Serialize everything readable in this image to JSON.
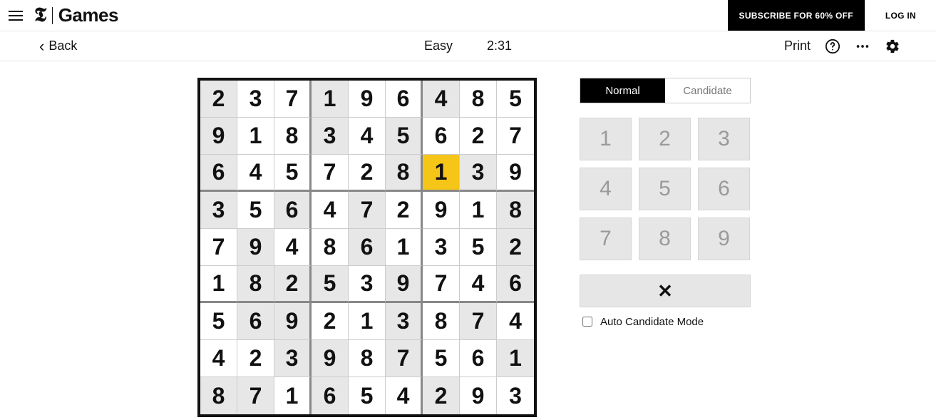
{
  "header": {
    "brand_prefix_glyph": "𝕿",
    "brand_text": "Games",
    "subscribe_label": "SUBSCRIBE FOR 60% OFF",
    "login_label": "LOG IN"
  },
  "toolbar": {
    "back_label": "Back",
    "difficulty": "Easy",
    "timer": "2:31",
    "print_label": "Print"
  },
  "panel": {
    "mode_normal": "Normal",
    "mode_candidate": "Candidate",
    "active_mode": "normal",
    "keys": [
      "1",
      "2",
      "3",
      "4",
      "5",
      "6",
      "7",
      "8",
      "9"
    ],
    "erase_glyph": "✕",
    "auto_label": "Auto Candidate Mode",
    "auto_checked": false
  },
  "sudoku": {
    "selected": {
      "row": 2,
      "col": 6
    },
    "grid": [
      [
        {
          "v": "2",
          "g": true
        },
        {
          "v": "3",
          "g": false
        },
        {
          "v": "7",
          "g": false
        },
        {
          "v": "1",
          "g": true
        },
        {
          "v": "9",
          "g": false
        },
        {
          "v": "6",
          "g": false
        },
        {
          "v": "4",
          "g": true
        },
        {
          "v": "8",
          "g": false
        },
        {
          "v": "5",
          "g": false
        }
      ],
      [
        {
          "v": "9",
          "g": true
        },
        {
          "v": "1",
          "g": false
        },
        {
          "v": "8",
          "g": false
        },
        {
          "v": "3",
          "g": true
        },
        {
          "v": "4",
          "g": false
        },
        {
          "v": "5",
          "g": true
        },
        {
          "v": "6",
          "g": false
        },
        {
          "v": "2",
          "g": false
        },
        {
          "v": "7",
          "g": false
        }
      ],
      [
        {
          "v": "6",
          "g": true
        },
        {
          "v": "4",
          "g": false
        },
        {
          "v": "5",
          "g": false
        },
        {
          "v": "7",
          "g": false
        },
        {
          "v": "2",
          "g": false
        },
        {
          "v": "8",
          "g": true
        },
        {
          "v": "1",
          "g": false
        },
        {
          "v": "3",
          "g": true
        },
        {
          "v": "9",
          "g": false
        }
      ],
      [
        {
          "v": "3",
          "g": true
        },
        {
          "v": "5",
          "g": false
        },
        {
          "v": "6",
          "g": true
        },
        {
          "v": "4",
          "g": false
        },
        {
          "v": "7",
          "g": true
        },
        {
          "v": "2",
          "g": false
        },
        {
          "v": "9",
          "g": false
        },
        {
          "v": "1",
          "g": false
        },
        {
          "v": "8",
          "g": true
        }
      ],
      [
        {
          "v": "7",
          "g": false
        },
        {
          "v": "9",
          "g": true
        },
        {
          "v": "4",
          "g": false
        },
        {
          "v": "8",
          "g": false
        },
        {
          "v": "6",
          "g": true
        },
        {
          "v": "1",
          "g": false
        },
        {
          "v": "3",
          "g": false
        },
        {
          "v": "5",
          "g": false
        },
        {
          "v": "2",
          "g": true
        }
      ],
      [
        {
          "v": "1",
          "g": false
        },
        {
          "v": "8",
          "g": true
        },
        {
          "v": "2",
          "g": true
        },
        {
          "v": "5",
          "g": true
        },
        {
          "v": "3",
          "g": false
        },
        {
          "v": "9",
          "g": true
        },
        {
          "v": "7",
          "g": false
        },
        {
          "v": "4",
          "g": false
        },
        {
          "v": "6",
          "g": true
        }
      ],
      [
        {
          "v": "5",
          "g": false
        },
        {
          "v": "6",
          "g": true
        },
        {
          "v": "9",
          "g": true
        },
        {
          "v": "2",
          "g": false
        },
        {
          "v": "1",
          "g": false
        },
        {
          "v": "3",
          "g": true
        },
        {
          "v": "8",
          "g": false
        },
        {
          "v": "7",
          "g": true
        },
        {
          "v": "4",
          "g": false
        }
      ],
      [
        {
          "v": "4",
          "g": false
        },
        {
          "v": "2",
          "g": false
        },
        {
          "v": "3",
          "g": true
        },
        {
          "v": "9",
          "g": true
        },
        {
          "v": "8",
          "g": false
        },
        {
          "v": "7",
          "g": true
        },
        {
          "v": "5",
          "g": false
        },
        {
          "v": "6",
          "g": false
        },
        {
          "v": "1",
          "g": true
        }
      ],
      [
        {
          "v": "8",
          "g": true
        },
        {
          "v": "7",
          "g": true
        },
        {
          "v": "1",
          "g": false
        },
        {
          "v": "6",
          "g": true
        },
        {
          "v": "5",
          "g": false
        },
        {
          "v": "4",
          "g": false
        },
        {
          "v": "2",
          "g": true
        },
        {
          "v": "9",
          "g": false
        },
        {
          "v": "3",
          "g": false
        }
      ]
    ]
  }
}
